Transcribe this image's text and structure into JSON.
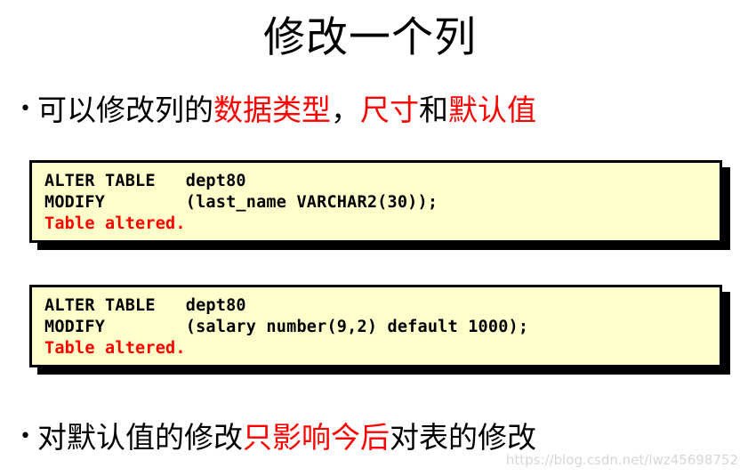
{
  "slide": {
    "title": "修改一个列",
    "background_color": "#ffffff",
    "accent_color": "#ff0000",
    "code_background_color": "#ffffcc"
  },
  "bullets": [
    {
      "marker": "•",
      "segments": [
        {
          "text": "可以修改列的",
          "color": "#000000"
        },
        {
          "text": "数据类型",
          "color": "#ff0000"
        },
        {
          "text": "，",
          "color": "#000000"
        },
        {
          "text": "尺寸",
          "color": "#ff0000"
        },
        {
          "text": "和",
          "color": "#000000"
        },
        {
          "text": "默认值",
          "color": "#ff0000"
        }
      ],
      "plain": "可以修改列的数据类型，尺寸和默认值"
    },
    {
      "marker": "•",
      "segments": [
        {
          "text": "对默认值的修改",
          "color": "#000000"
        },
        {
          "text": "只影响今后",
          "color": "#ff0000"
        },
        {
          "text": "对表的修改",
          "color": "#000000"
        }
      ],
      "plain": "对默认值的修改只影响今后对表的修改"
    }
  ],
  "code_blocks": [
    {
      "lines": [
        {
          "text": "ALTER TABLE   dept80",
          "color": "#000000"
        },
        {
          "text": "MODIFY        (last_name VARCHAR2(30));",
          "color": "#000000"
        },
        {
          "text": "Table altered.",
          "color": "#ff0000"
        }
      ]
    },
    {
      "lines": [
        {
          "text": "ALTER TABLE   dept80",
          "color": "#000000"
        },
        {
          "text": "MODIFY        (salary number(9,2) default 1000);",
          "color": "#000000"
        },
        {
          "text": "Table altered.",
          "color": "#ff0000"
        }
      ]
    }
  ],
  "watermark": {
    "text": "https://blog.csdn.net/lwz45698752"
  }
}
